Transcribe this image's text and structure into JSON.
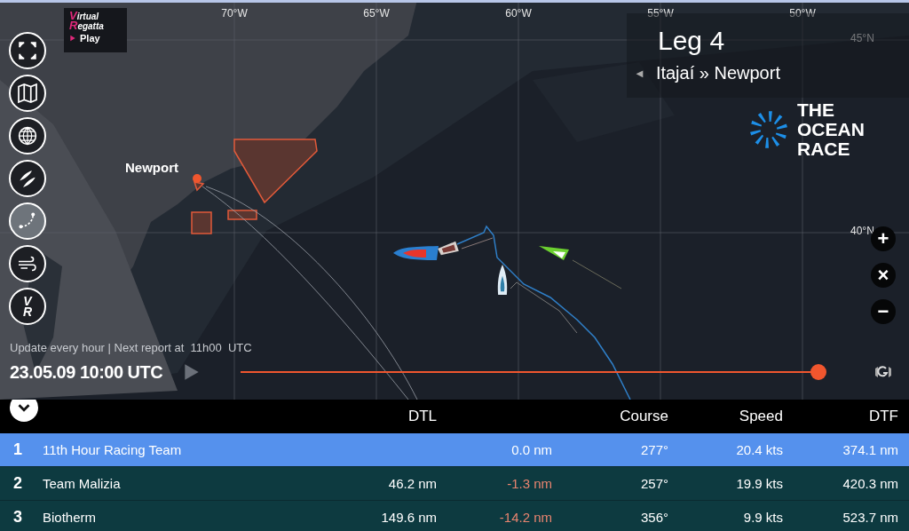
{
  "brand": {
    "logo_lines": [
      "Virtual",
      "Regatta"
    ],
    "play": "Play"
  },
  "tools": [
    {
      "kind": "fullscreen",
      "selected": false
    },
    {
      "kind": "map",
      "selected": false
    },
    {
      "kind": "globe",
      "selected": false
    },
    {
      "kind": "boats",
      "selected": false
    },
    {
      "kind": "route",
      "selected": true
    },
    {
      "kind": "wind",
      "selected": false
    },
    {
      "kind": "vr",
      "label": "VR",
      "selected": false
    }
  ],
  "grid": {
    "longitudes": [
      "70°W",
      "65°W",
      "60°W",
      "55°W",
      "50°W"
    ],
    "latitudes": [
      "45°N",
      "40°N"
    ]
  },
  "place_label": "Newport",
  "leg": {
    "back": "◄",
    "title": "Leg 4",
    "route": "Itajaí » Newport"
  },
  "race_logo": [
    "THE",
    "OCEAN",
    "RACE"
  ],
  "zoom_controls": [
    "+",
    "×",
    "−"
  ],
  "timeline": {
    "note": "Update every hour | Next report at  11h00  UTC",
    "time": "23.05.09 10:00 UTC",
    "level": 1
  },
  "table": {
    "columns": [
      {
        "label": "DTL"
      },
      {
        "label": "Course"
      },
      {
        "label": "Speed"
      },
      {
        "label": "DTF"
      }
    ],
    "rows": [
      {
        "rank": "1",
        "team": "11th Hour Racing Team",
        "column_3": "0.0 nm",
        "color": "#ffffff",
        "course": "277°",
        "speed": "20.4 kts",
        "dtf": "374.1 nm",
        "selected": true
      },
      {
        "rank": "2",
        "team": "Team Malizia",
        "dtl": "46.2 nm",
        "column_3": "-1.3 nm",
        "color": "#e8846f",
        "course": "257°",
        "speed": "19.9 kts",
        "dtf": "420.3 nm",
        "selected": false
      },
      {
        "rank": "3",
        "team": "Biotherm",
        "dtl": "149.6 nm",
        "column_3": "-14.2 nm",
        "color": "#e8846f",
        "course": "356°",
        "speed": "9.9 kts",
        "dtf": "523.7 nm",
        "selected": false
      }
    ]
  }
}
